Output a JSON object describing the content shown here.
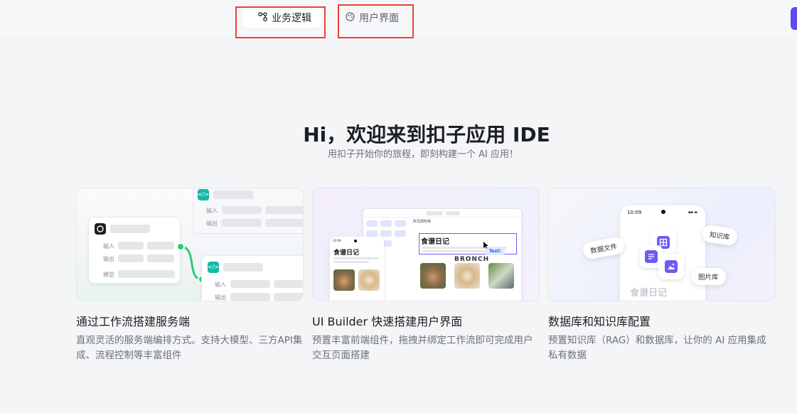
{
  "header": {
    "tabs": [
      {
        "label": "业务逻辑",
        "icon": "workflow-nodes-icon",
        "active": true
      },
      {
        "label": "用户界面",
        "icon": "palette-icon",
        "active": false
      }
    ],
    "accent_color": "#5a4af0",
    "highlight_color": "#e8413a"
  },
  "hero": {
    "title": "Hi，欢迎来到扣子应用 IDE",
    "subtitle": "用扣子开始你的旅程，即刻构建一个 AI 应用！"
  },
  "cards": [
    {
      "title": "通过工作流搭建服务端",
      "description": "直观灵活的服务端编排方式。支持大模型、三方API集成、流程控制等丰富组件",
      "illustration": {
        "labels": {
          "input": "输入",
          "output": "输出",
          "model": "模型"
        },
        "colors": {
          "link": "#2ecc71",
          "node": "#14b8a6"
        }
      }
    },
    {
      "title": "UI Builder 快速搭建用户界面",
      "description": "预置丰富前端组件，拖拽并绑定工作流即可完成用户交互页面搭建",
      "illustration": {
        "phone_title": "食谱日记",
        "canvas_title": "食谱日记",
        "brand_text": "BRONCH",
        "test_badge": "Test!",
        "editor_title": "所见即所得",
        "time": "10:09"
      }
    },
    {
      "title": "数据库和知识库配置",
      "description": "预置知识库（RAG）和数据库，让你的 AI 应用集成私有数据",
      "illustration": {
        "time": "10:09",
        "tags": [
          "知识库",
          "数据文件",
          "图片库"
        ],
        "faded_title": "食谱日记"
      }
    }
  ]
}
